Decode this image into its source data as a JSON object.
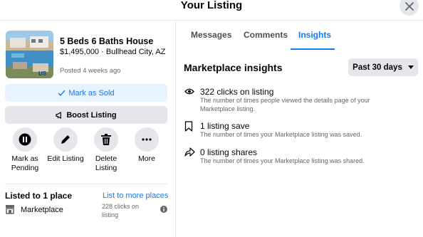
{
  "header": {
    "title": "Your Listing",
    "close_icon": "close-icon"
  },
  "listing": {
    "title": "5 Beds 6 Baths House",
    "price_location": "$1,495,000 · Bullhead City, AZ",
    "posted": "Posted 4 weeks ago",
    "thumbnail_badge": "US"
  },
  "buttons": {
    "mark_sold": "Mark as Sold",
    "boost": "Boost Listing"
  },
  "actions": [
    {
      "label": "Mark as Pending",
      "icon": "pause-icon"
    },
    {
      "label": "Edit Listing",
      "icon": "pencil-icon"
    },
    {
      "label": "Delete Listing",
      "icon": "trash-icon"
    },
    {
      "label": "More",
      "icon": "more-icon"
    }
  ],
  "listed": {
    "title": "Listed to 1 place",
    "more_link": "List to more places",
    "place": "Marketplace",
    "clicks": "228 clicks on listing"
  },
  "tabs": {
    "messages": "Messages",
    "comments": "Comments",
    "insights": "Insights"
  },
  "insights": {
    "title": "Marketplace insights",
    "period": "Past 30 days",
    "stats": [
      {
        "main": "322 clicks on listing",
        "desc": "The number of times people viewed the details page of your Marketplace listing.",
        "icon": "eye-icon"
      },
      {
        "main": "1 listing save",
        "desc": "The number of times your Marketplace listing was saved.",
        "icon": "bookmark-icon"
      },
      {
        "main": "0 listing shares",
        "desc": "The number of times your Marketplace listing was shared.",
        "icon": "share-icon"
      }
    ]
  },
  "colors": {
    "accent": "#1877f2",
    "light_accent": "#e7f3ff",
    "button_gray": "#e4e6eb",
    "secondary_text": "#65676b"
  }
}
